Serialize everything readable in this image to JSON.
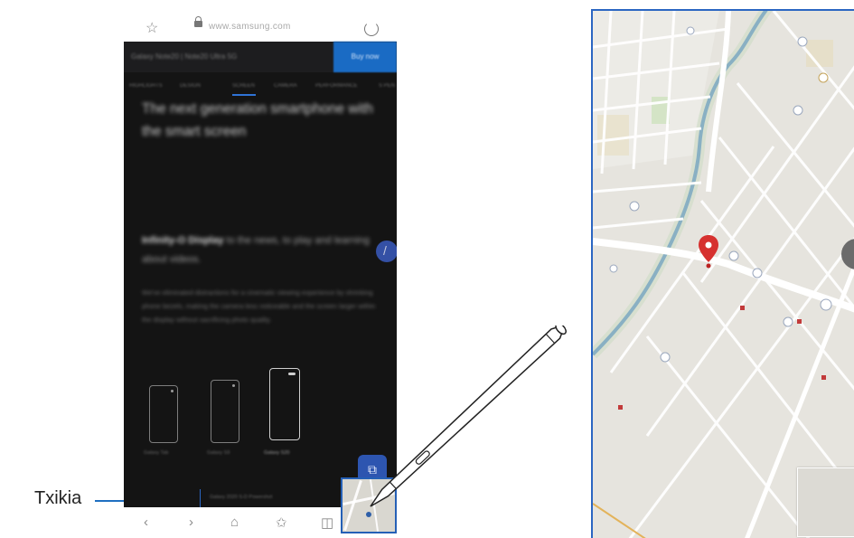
{
  "callout": {
    "label": "Txikia"
  },
  "browser": {
    "star_icon": "☆",
    "url": "www.samsung.com",
    "reload_icon": "reload-icon",
    "promo": {
      "text": "Galaxy Note20 | Note20 Ultra 5G",
      "button": "Buy now"
    },
    "tabs": [
      "HIGHLIGHTS",
      "DESIGN",
      "SCREEN",
      "CAMERA",
      "PERFORMANCE",
      "S PEN"
    ],
    "headline": "The next generation smartphone with the smart screen",
    "sub_bold": "Infinity-O Display",
    "sub_rest": " to the news, to play and learning about videos.",
    "paragraph": "We've eliminated distractions for a cinematic viewing experience by shrinking phone bezels, making the camera less noticeable and the screen larger within the display without sacrificing photo quality.",
    "devices": [
      "Galaxy Tab",
      "Galaxy S9",
      "Galaxy S20"
    ],
    "bottom_strip": "Galaxy 2020 S-D Powershot",
    "chat_icon": "⧉",
    "nav": [
      "‹",
      "›",
      "⌂",
      "✩",
      "◫"
    ]
  },
  "colors": {
    "accent": "#2b66c2",
    "pin": "#d6312f",
    "page_bg": "#141414"
  }
}
